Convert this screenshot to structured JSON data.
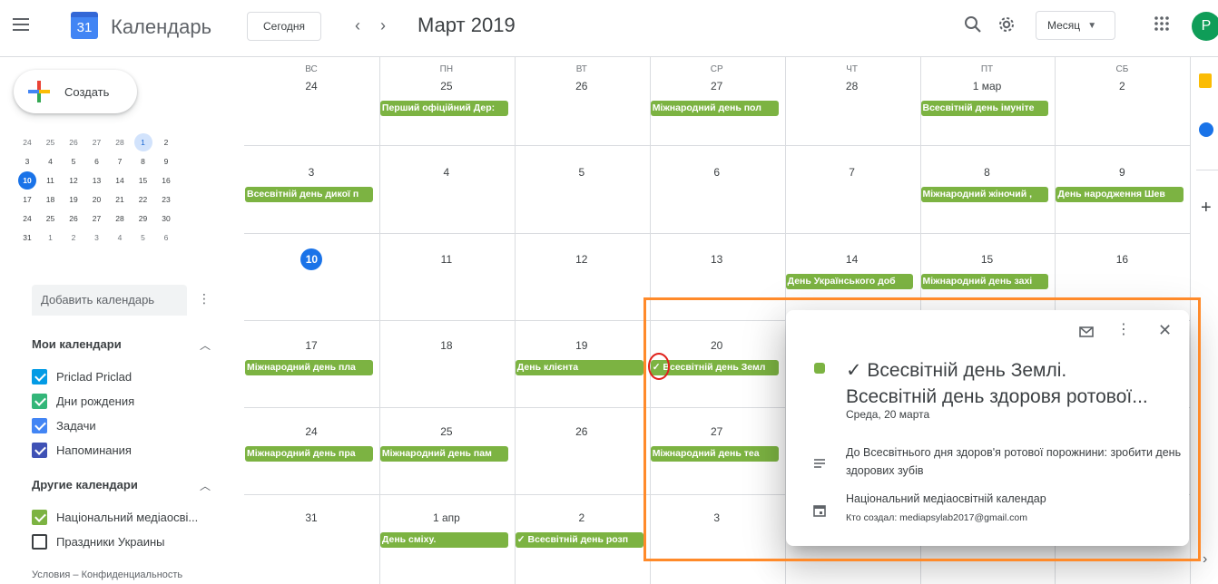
{
  "header": {
    "logo_day": "31",
    "app_title": "Календарь",
    "today_label": "Сегодня",
    "prev_icon": "‹",
    "next_icon": "›",
    "month_title": "Март 2019",
    "view_label": "Месяц",
    "avatar_letter": "P"
  },
  "sidebar": {
    "create_label": "Создать",
    "mini_calendar": [
      [
        "24",
        "25",
        "26",
        "27",
        "28",
        "1",
        "2"
      ],
      [
        "3",
        "4",
        "5",
        "6",
        "7",
        "8",
        "9"
      ],
      [
        "10",
        "11",
        "12",
        "13",
        "14",
        "15",
        "16"
      ],
      [
        "17",
        "18",
        "19",
        "20",
        "21",
        "22",
        "23"
      ],
      [
        "24",
        "25",
        "26",
        "27",
        "28",
        "29",
        "30"
      ],
      [
        "31",
        "1",
        "2",
        "3",
        "4",
        "5",
        "6"
      ]
    ],
    "add_calendar_placeholder": "Добавить календарь",
    "more_icon": "⋮",
    "my_calendars_title": "Мои календари",
    "my_calendars": [
      {
        "label": "Priclad Priclad",
        "color": "#039be5"
      },
      {
        "label": "Дни рождения",
        "color": "#33b679"
      },
      {
        "label": "Задачи",
        "color": "#4285f4"
      },
      {
        "label": "Напоминания",
        "color": "#3f51b5"
      }
    ],
    "other_calendars_title": "Другие календари",
    "other_calendars": [
      {
        "label": "Національний медіаосві...",
        "color": "#7cb342",
        "checked": true
      },
      {
        "label": "Праздники Украины",
        "color": "#0b8043",
        "checked": false
      }
    ],
    "footer": "Условия – Конфиденциальность"
  },
  "grid": {
    "days_of_week": [
      "ВС",
      "ПН",
      "ВТ",
      "СР",
      "ЧТ",
      "ПТ",
      "СБ"
    ],
    "weeks": [
      {
        "days": [
          "24",
          "25",
          "26",
          "27",
          "28",
          "1 мар",
          "2"
        ]
      },
      {
        "days": [
          "3",
          "4",
          "5",
          "6",
          "7",
          "8",
          "9"
        ]
      },
      {
        "days": [
          "10",
          "11",
          "12",
          "13",
          "14",
          "15",
          "16"
        ]
      },
      {
        "days": [
          "17",
          "18",
          "19",
          "20",
          "",
          "",
          ""
        ]
      },
      {
        "days": [
          "24",
          "25",
          "26",
          "27",
          "",
          "",
          ""
        ]
      },
      {
        "days": [
          "31",
          "1 апр",
          "2",
          "3",
          "",
          "",
          ""
        ]
      }
    ],
    "events": [
      {
        "week": 0,
        "col": 1,
        "title": "Перший офіційний Дер:"
      },
      {
        "week": 0,
        "col": 3,
        "title": "Міжнародний день пол"
      },
      {
        "week": 0,
        "col": 5,
        "title": "Всесвітній день імуніте"
      },
      {
        "week": 1,
        "col": 0,
        "title": "Всесвітній день дикої п"
      },
      {
        "week": 1,
        "col": 5,
        "title": "Міжнародний жіночий ,"
      },
      {
        "week": 1,
        "col": 6,
        "title": "День народження Шев"
      },
      {
        "week": 2,
        "col": 4,
        "title": "День Українського доб"
      },
      {
        "week": 2,
        "col": 5,
        "title": "Міжнародний день захі"
      },
      {
        "week": 3,
        "col": 0,
        "title": "Міжнародний день пла"
      },
      {
        "week": 3,
        "col": 2,
        "title": "День клієнта"
      },
      {
        "week": 3,
        "col": 3,
        "title": "✓ Всесвітній день Земл"
      },
      {
        "week": 4,
        "col": 0,
        "title": "Міжнародний день пра"
      },
      {
        "week": 4,
        "col": 1,
        "title": "Міжнародний день пам"
      },
      {
        "week": 4,
        "col": 3,
        "title": "Міжнародний день теа"
      },
      {
        "week": 5,
        "col": 1,
        "title": "День сміху."
      },
      {
        "week": 5,
        "col": 2,
        "title": "✓ Всесвітній день розп"
      }
    ]
  },
  "popup": {
    "title_line1": "✓ Всесвітній день Землі.",
    "title_line2": "Всесвітній день здоровя ротової...",
    "date": "Среда, 20 марта",
    "description": "До Всесвітнього дня здоров'я ротової порожнини: зробити день здорових зубів",
    "calendar": "Національний медіаосвітній календар",
    "creator": "Кто создал: mediapsylab2017@gmail.com"
  }
}
